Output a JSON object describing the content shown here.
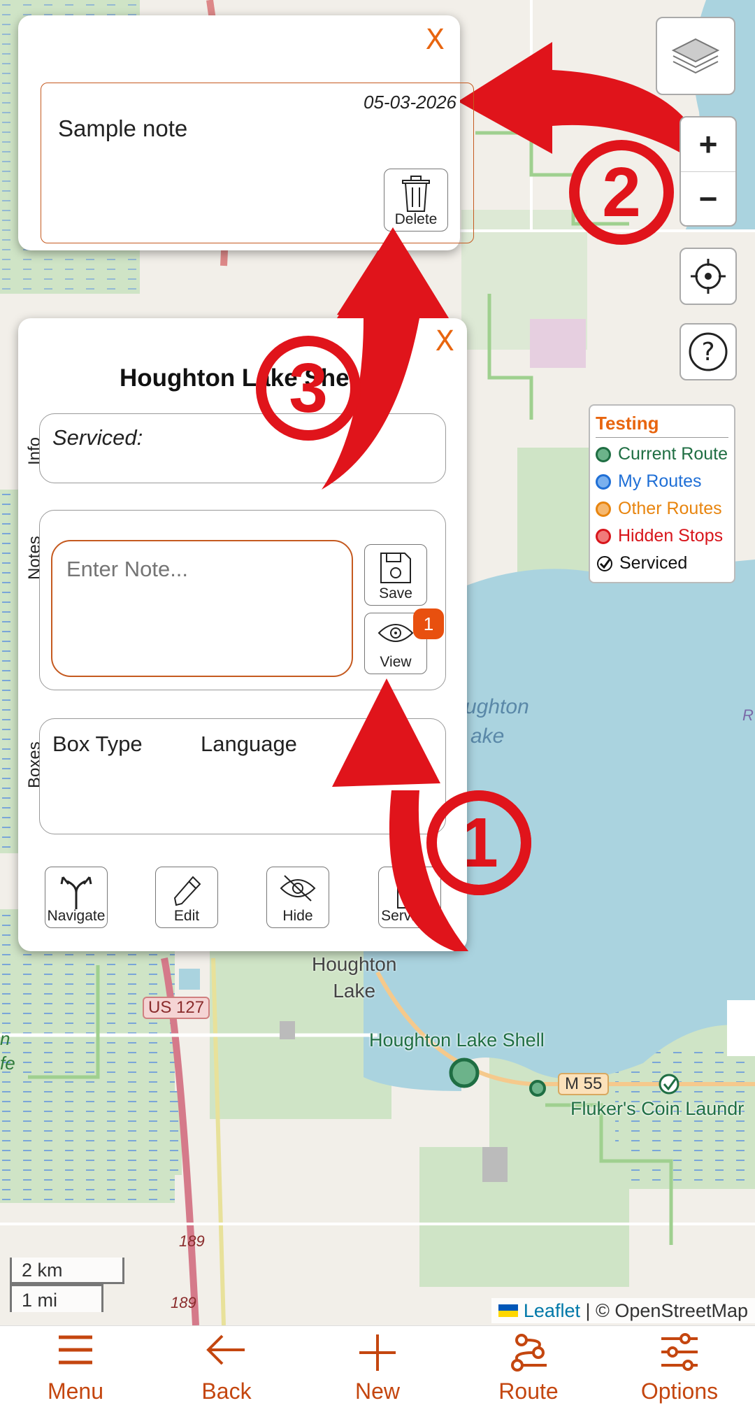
{
  "note_popup": {
    "close_label": "X",
    "date": "05-03-2026",
    "text": "Sample note",
    "delete_label": "Delete"
  },
  "stop_popup": {
    "close_label": "X",
    "title": "Houghton Lake She",
    "info_legend": "Info",
    "serviced_label": "Serviced:",
    "notes_legend": "Notes",
    "note_placeholder": "Enter Note...",
    "save_label": "Save",
    "view_label": "View",
    "view_badge": "1",
    "boxes_legend": "Boxes",
    "box_type_header": "Box Type",
    "language_header": "Language",
    "actions": {
      "navigate": "Navigate",
      "edit": "Edit",
      "hide": "Hide",
      "serviced": "Serviced"
    }
  },
  "annotations": {
    "arrow_1": "1",
    "arrow_2": "2",
    "arrow_3": "3"
  },
  "legend": {
    "title": "Testing",
    "items": [
      {
        "label": "Current Route",
        "color": "#1f6e43"
      },
      {
        "label": "My Routes",
        "color": "#1f6fd6"
      },
      {
        "label": "Other Routes",
        "color": "#e8850f"
      },
      {
        "label": "Hidden Stops",
        "color": "#d8151b"
      },
      {
        "label": "Serviced",
        "color": "#111111"
      }
    ],
    "title_color": "#e8650f"
  },
  "map": {
    "zoom_in": "+",
    "zoom_out": "−",
    "scale_km": "2 km",
    "scale_mi": "1 mi",
    "labels": {
      "town": "Houghton",
      "town2": "Lake",
      "lake": "ughton",
      "lake2": "ake",
      "stop1": "Houghton Lake Shell",
      "stop2": "Fluker's Coin Laundr",
      "road_us127": "US 127",
      "road_m55": "M 55",
      "road_189a": "189",
      "road_189b": "189",
      "edge_r": "R",
      "edge_fe": "fe",
      "edge_h": "n"
    },
    "attribution_leaflet": "Leaflet",
    "attribution_rest": " | © OpenStreetMap"
  },
  "nav": {
    "menu": "Menu",
    "back": "Back",
    "new": "New",
    "route": "Route",
    "options": "Options"
  },
  "colors": {
    "accent": "#c4460f",
    "arrow_red": "#e0141b"
  }
}
